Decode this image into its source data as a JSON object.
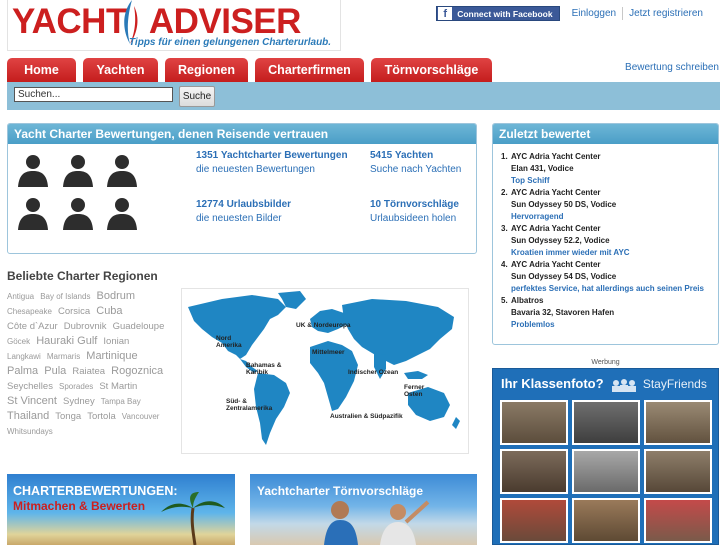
{
  "logo": {
    "part1": "YACHT",
    "part2": "ADVISER",
    "tagline": "Tipps für einen gelungenen Charterurlaub."
  },
  "header": {
    "facebook_label": "Connect with Facebook",
    "login": "Einloggen",
    "register": "Jetzt registrieren"
  },
  "nav": {
    "tabs": [
      {
        "label": "Home"
      },
      {
        "label": "Yachten"
      },
      {
        "label": "Regionen"
      },
      {
        "label": "Charterfirmen"
      },
      {
        "label": "Törnvorschläge"
      }
    ],
    "write_review": "Bewertung schreiben"
  },
  "search": {
    "value": "Suchen...",
    "button": "Suche"
  },
  "main_panel": {
    "title": "Yacht Charter Bewertungen, denen Reisende vertrauen",
    "stats": [
      {
        "big": "1351 Yachtcharter Bewertungen",
        "sub": "die neuesten Bewertungen"
      },
      {
        "big": "5415 Yachten",
        "sub": "Suche nach Yachten"
      },
      {
        "big": "12774 Urlaubsbilder",
        "sub": "die neuesten Bilder"
      },
      {
        "big": "10 Törnvorschläge",
        "sub": "Urlaubsideen holen"
      }
    ]
  },
  "regions": {
    "title": "Beliebte Charter Regionen",
    "cloud": [
      {
        "t": "Antigua",
        "s": 1
      },
      {
        "t": "Bay of Islands",
        "s": 1
      },
      {
        "t": "Bodrum",
        "s": 3
      },
      {
        "t": "Chesapeake",
        "s": 1
      },
      {
        "t": "Corsica",
        "s": 2
      },
      {
        "t": "Cuba",
        "s": 3
      },
      {
        "t": "Côte d`Azur",
        "s": 2
      },
      {
        "t": "Dubrovnik",
        "s": 2
      },
      {
        "t": "Guadeloupe",
        "s": 2
      },
      {
        "t": "Göcek",
        "s": 1
      },
      {
        "t": "Hauraki Gulf",
        "s": 3
      },
      {
        "t": "Ionian",
        "s": 2
      },
      {
        "t": "Langkawi",
        "s": 1
      },
      {
        "t": "Marmaris",
        "s": 1
      },
      {
        "t": "Martinique",
        "s": 3
      },
      {
        "t": "Palma",
        "s": 3
      },
      {
        "t": "Pula",
        "s": 3
      },
      {
        "t": "Raiatea",
        "s": 2
      },
      {
        "t": "Rogoznica",
        "s": 3
      },
      {
        "t": "Seychelles",
        "s": 2
      },
      {
        "t": "Sporades",
        "s": 1
      },
      {
        "t": "St Martin",
        "s": 2
      },
      {
        "t": "St Vincent",
        "s": 3
      },
      {
        "t": "Sydney",
        "s": 2
      },
      {
        "t": "Tampa Bay",
        "s": 1
      },
      {
        "t": "Thailand",
        "s": 3
      },
      {
        "t": "Tonga",
        "s": 2
      },
      {
        "t": "Tortola",
        "s": 2
      },
      {
        "t": "Vancouver",
        "s": 1
      },
      {
        "t": "Whitsundays",
        "s": 1
      }
    ]
  },
  "map_labels": {
    "nord": "Nord\nAmerika",
    "bahamas": "Bahamas &\nKaribik",
    "sued": "Süd- &\nZentralamerika",
    "uk": "UK & Nordeuropa",
    "mittel": "Mittelmeer",
    "indisch": "Indischer Ozean",
    "ferner": "Ferner\nOsten",
    "aus": "Australien & Südpazifik"
  },
  "banners": {
    "left_title": "CHARTERBEWERTUNGEN:",
    "left_sub": "Mitmachen & Bewerten",
    "right_title": "Yachtcharter Törnvorschläge"
  },
  "recent": {
    "title": "Zuletzt bewertet",
    "items": [
      {
        "num": "1.",
        "company": "AYC Adria Yacht Center",
        "boat": "Elan 431, Vodice",
        "review": "Top Schiff"
      },
      {
        "num": "2.",
        "company": "AYC Adria Yacht Center",
        "boat": "Sun Odyssey 50 DS, Vodice",
        "review": "Hervorragend"
      },
      {
        "num": "3.",
        "company": "AYC Adria Yacht Center",
        "boat": "Sun Odyssey 52.2, Vodice",
        "review": "Kroatien immer wieder mit AYC"
      },
      {
        "num": "4.",
        "company": "AYC Adria Yacht Center",
        "boat": "Sun Odyssey 54 DS, Vodice",
        "review": "perfektes Service, hat allerdings auch seinen Preis"
      },
      {
        "num": "5.",
        "company": "Albatros",
        "boat": "Bavaria 32, Stavoren Hafen",
        "review": "Problemlos"
      }
    ]
  },
  "ad": {
    "label": "Werbung",
    "headline": "Ihr Klassenfoto?",
    "brand": "StayFriends"
  },
  "colors": {
    "nav_red": "#cc1f1f",
    "panel_blue": "#4a9ec7",
    "link_blue": "#2b6fb6",
    "map_blue": "#1f86c3"
  }
}
